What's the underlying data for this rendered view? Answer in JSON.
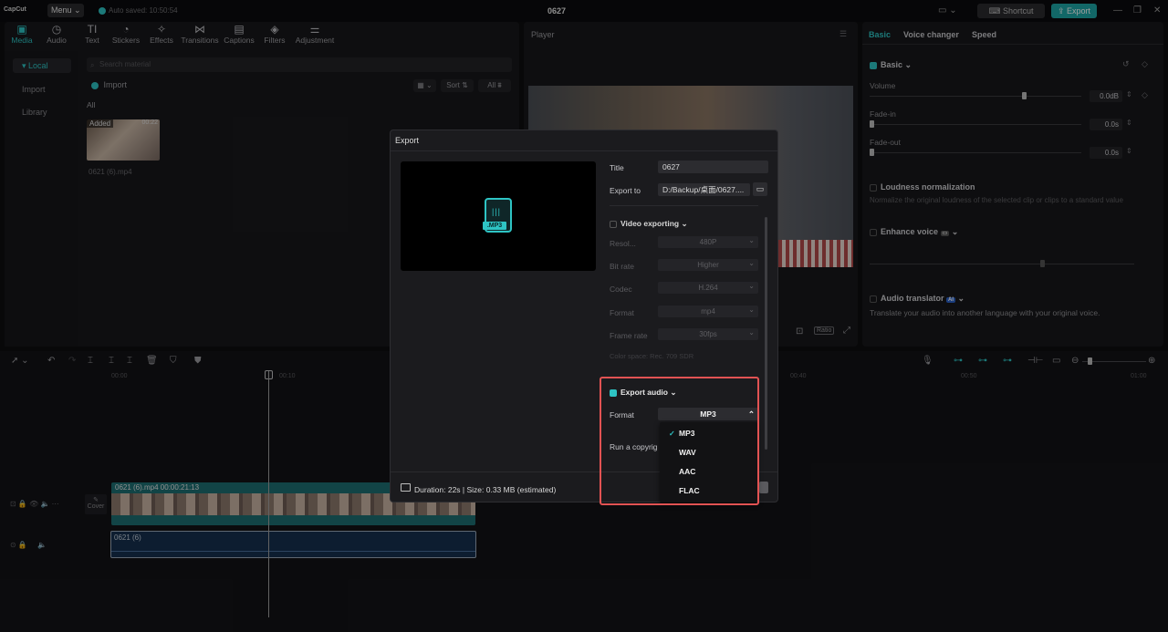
{
  "app": {
    "logo": "CapCut",
    "menu_label": "Menu",
    "autosave": "Auto saved: 10:50:54",
    "project_title": "0627",
    "shortcut_label": "Shortcut",
    "export_label": "Export"
  },
  "toolbar": [
    {
      "label": "Media",
      "icon": "media-icon"
    },
    {
      "label": "Audio",
      "icon": "audio-icon"
    },
    {
      "label": "Text",
      "icon": "text-icon"
    },
    {
      "label": "Stickers",
      "icon": "sticker-icon"
    },
    {
      "label": "Effects",
      "icon": "effects-icon"
    },
    {
      "label": "Transitions",
      "icon": "transitions-icon"
    },
    {
      "label": "Captions",
      "icon": "captions-icon"
    },
    {
      "label": "Filters",
      "icon": "filters-icon"
    },
    {
      "label": "Adjustment",
      "icon": "adjustment-icon"
    }
  ],
  "media_sidebar": [
    "Local",
    "Import",
    "Library"
  ],
  "media": {
    "search_placeholder": "Search material",
    "import_label": "Import",
    "sort_label": "Sort",
    "all_label": "All",
    "filter_all": "All",
    "clip_tag": "Added",
    "clip_duration": "00:22",
    "clip_name": "0621 (6).mp4"
  },
  "player": {
    "title": "Player",
    "ratio_label": "Ratio"
  },
  "right_panel": {
    "tabs": [
      "Basic",
      "Voice changer",
      "Speed"
    ],
    "basic_label": "Basic",
    "volume_label": "Volume",
    "volume_value": "0.0dB",
    "fadein_label": "Fade-in",
    "fadein_value": "0.0s",
    "fadeout_label": "Fade-out",
    "fadeout_value": "0.0s",
    "loudness_label": "Loudness normalization",
    "loudness_desc": "Normalize the original loudness of the selected clip or clips to a standard value",
    "enhance_label": "Enhance voice",
    "translator_label": "Audio translator",
    "translator_badge": "AI",
    "translator_desc": "Translate your audio into another language with your original voice."
  },
  "timeline": {
    "ruler": [
      "00:00",
      "00:10",
      "00:40",
      "00:50",
      "01:00"
    ],
    "video_clip_label": "0621 (6).mp4  00:00:21:13",
    "audio_clip_label": "0621 (6)",
    "cover_label": "Cover"
  },
  "export_dialog": {
    "title": "Export",
    "title_label": "Title",
    "title_value": "0627",
    "export_to_label": "Export to",
    "export_to_value": "D:/Backup/桌面/0627....",
    "video_section": "Video exporting",
    "video_fields": [
      {
        "label": "Resol...",
        "value": "480P"
      },
      {
        "label": "Bit rate",
        "value": "Higher"
      },
      {
        "label": "Codec",
        "value": "H.264"
      },
      {
        "label": "Format",
        "value": "mp4"
      },
      {
        "label": "Frame rate",
        "value": "30fps"
      }
    ],
    "color_space": "Color space: Rec. 709 SDR",
    "audio_section": "Export audio",
    "audio_format_label": "Format",
    "audio_format_value": "MP3",
    "copyright_label": "Run a copyrig",
    "format_options": [
      "MP3",
      "WAV",
      "AAC",
      "FLAC"
    ],
    "selected_option": "MP3",
    "preview_badge": ".MP3",
    "footer": "Duration: 22s | Size: 0.33 MB (estimated)"
  },
  "colors": {
    "accent": "#2ec4c4",
    "highlight": "#e25353"
  }
}
